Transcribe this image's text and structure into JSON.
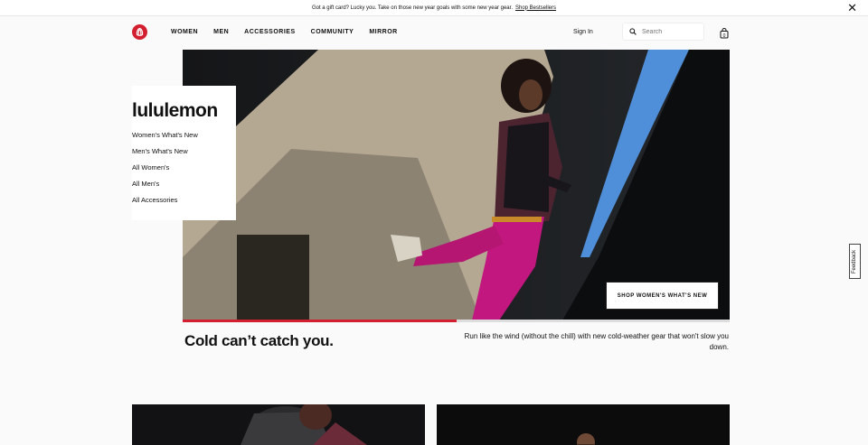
{
  "promo": {
    "text": "Got a gift card? Lucky you. Take on those new year goals with some new year gear.",
    "link": "Shop Bestsellers",
    "close_glyph": "✕"
  },
  "nav": {
    "logo": "lululemon-logo-icon",
    "items": [
      "WOMEN",
      "MEN",
      "ACCESSORIES",
      "COMMUNITY",
      "MIRROR"
    ],
    "signin": "Sign In",
    "search_placeholder": "Search",
    "bag_count": "0"
  },
  "hero": {
    "card_title": "lululemon",
    "card_links": [
      "Women's What's New",
      "Men's What's New",
      "All Women's",
      "All Men's",
      "All Accessories"
    ],
    "cta": "SHOP WOMEN'S WHAT'S NEW",
    "headline": "Cold can’t catch you.",
    "subtext": "Run like the wind (without the chill) with new cold-weather gear that won't slow you down.",
    "carousel_progress": 0.5
  },
  "feedback": "Feedback",
  "colors": {
    "brand": "#d22030",
    "text": "#111111",
    "background": "#fafafa"
  }
}
